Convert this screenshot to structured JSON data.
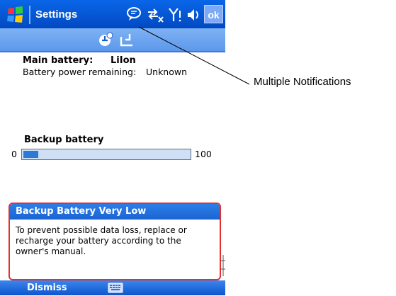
{
  "titlebar": {
    "title": "Settings",
    "ok_label": "ok",
    "icons": [
      "start-menu-icon",
      "notification-icon",
      "connectivity-icon",
      "signal-icon",
      "volume-icon"
    ]
  },
  "toolbar": {
    "icons": [
      "power-icon",
      "backup-icon"
    ]
  },
  "main_battery": {
    "label": "Main battery:",
    "value": "LiIon",
    "remaining_label": "Battery power remaining:",
    "remaining_value": "Unknown"
  },
  "backup_battery": {
    "label": "Backup battery",
    "min": "0",
    "max": "100",
    "level_percent": 9
  },
  "notification": {
    "title": "Backup Battery Very Low",
    "body": "To prevent possible data loss, replace or recharge your battery according to the owner's manual."
  },
  "menubar": {
    "left_label": "Dismiss",
    "input_icon": "keyboard-icon"
  },
  "callout": {
    "text": "Multiple Notifications"
  },
  "colors": {
    "titlebar": "#0249c2",
    "accent_red": "#e03030",
    "bar_fill": "#2b7ad8"
  }
}
